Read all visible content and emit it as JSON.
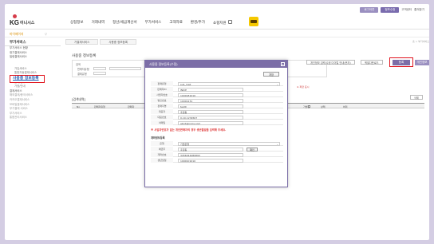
{
  "util": {
    "b1": "로그아웃",
    "b2": "정보수정",
    "b3": "고객센터",
    "b4": "즐겨찾기",
    "colors": {
      "b1": "#9a8fc0",
      "b2": "#7a6cae"
    }
  },
  "header": {
    "logo_kg": "KG",
    "logo_inis": "이니시스",
    "nav": [
      "상점정보",
      "거래내역",
      "정산/세금계산서",
      "부가서비스",
      "고객자료",
      "환경/추가",
      "쇼핑지원"
    ]
  },
  "crumb": {
    "home": "마이페이지",
    "extra": "▽"
  },
  "sidebar": {
    "title": "부가서비스",
    "items": [
      "부가서비스 현황",
      "정기결제서비스",
      "빌링결제서비스",
      "사용중 정보등록",
      "가입서비스",
      "통합자동결제서비스",
      "현금영수증",
      "인지/인수",
      "가정/안내",
      "결제서비스",
      "해외결제/중국서비스",
      "카카오결제서비스",
      "모바일결제서비스",
      "부가결제 서비스",
      "부가서비스",
      "통합관리서비스"
    ],
    "selected": "사용중 정보등록"
  },
  "main": {
    "tabs": [
      "가결제서비스",
      "사용중 정보등록"
    ],
    "breadcrumb_right": "홈 > 부가서비스",
    "page_title": "사용중 정보등록",
    "filter_label": "검색",
    "filter_items": [
      "판매자유형",
      "결제유형"
    ],
    "filter_note": "※ 해당하는",
    "red_hint": "※ 파란 표시",
    "btn_inquiry": "개인정보 입력/수정 다이얼 안내(문자)",
    "btn_excel": "엑셀다운로드",
    "btn_register": "등록",
    "btn_extra": "개인정보",
    "list_title": "[검색내역]",
    "list_btn": "삭제",
    "columns": [
      "No",
      "판매자유형",
      "판매자",
      "가맹점",
      "상태",
      "처리"
    ]
  },
  "modal": {
    "title": "사용중 정보등록(수정)",
    "close": "×",
    "save": "저장",
    "fields": [
      {
        "label": "판매유형",
        "value": "sub_mall",
        "select": true
      },
      {
        "label": "판매자ID",
        "value": "INICE"
      },
      {
        "label": "사업자번호",
        "value": "1000181010"
      },
      {
        "label": "법인번호",
        "value": "10001231"
      },
      {
        "label": "판매자명",
        "value": "test0"
      },
      {
        "label": "대표자",
        "value": "홍길동"
      },
      {
        "label": "대표번호",
        "value": "0-10-1234567"
      },
      {
        "label": "이메일",
        "value": "abcd@inicis.com"
      }
    ],
    "warn": "※ 사업자번호가 없는 개인판매자의 경우 생년월일을 입력해 주세요.",
    "sub_title": "계좌정보등록",
    "bank_fields": [
      {
        "label": "은행",
        "value": "기업은행",
        "select": true
      },
      {
        "label": "예금주",
        "value": "홍길동",
        "btn": "확인"
      },
      {
        "label": "계좌번호",
        "value": "3456344489893"
      },
      {
        "label": "생년월일",
        "value": "1990101010"
      }
    ]
  }
}
